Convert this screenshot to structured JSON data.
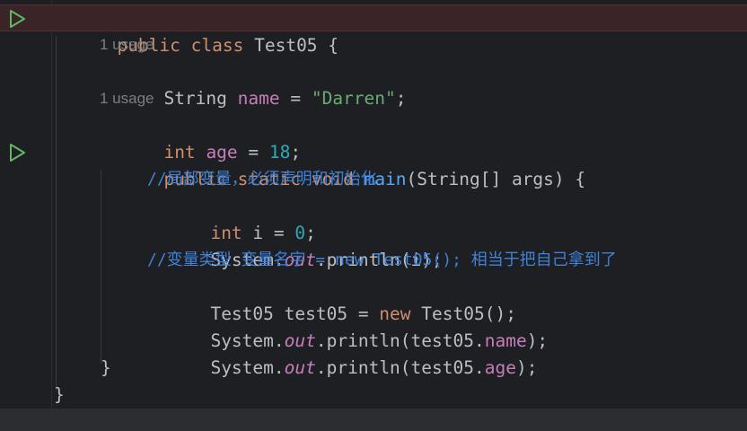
{
  "editor": {
    "lines": [
      {
        "id": "l1",
        "tokens": [
          "public",
          " ",
          "class",
          " ",
          "Test05",
          " {"
        ]
      },
      {
        "id": "h1",
        "hint": "1 usage"
      },
      {
        "id": "l2",
        "tokens": [
          "String",
          " ",
          "name",
          " = ",
          "\"Darren\"",
          ";"
        ]
      },
      {
        "id": "h2",
        "hint": "1 usage"
      },
      {
        "id": "l3",
        "tokens": [
          "int",
          " ",
          "age",
          " = ",
          "18",
          ";"
        ]
      },
      {
        "id": "l4",
        "tokens": [
          "public",
          " ",
          "static",
          " ",
          "void",
          " ",
          "main",
          "(String[] args) {"
        ]
      },
      {
        "id": "l5",
        "comment": "//局部变量，必须声明和初始化"
      },
      {
        "id": "l6",
        "tokens": [
          "int",
          " i = ",
          "0",
          ";"
        ]
      },
      {
        "id": "l7",
        "tokens": [
          "System.",
          "out",
          ".println(i);"
        ]
      },
      {
        "id": "l8",
        "comment": "//变量类型 变量名字 = new Test05(); 相当于把自己拿到了"
      },
      {
        "id": "l9",
        "tokens": [
          "Test05 test05 = ",
          "new",
          " Test05();"
        ]
      },
      {
        "id": "l10",
        "tokens": [
          "System.",
          "out",
          ".println(test05.",
          "name",
          ");"
        ]
      },
      {
        "id": "l11",
        "tokens": [
          "System.",
          "out",
          ".println(test05.",
          "age",
          ");"
        ]
      },
      {
        "id": "l12",
        "tokens": [
          "}"
        ]
      },
      {
        "id": "l13",
        "tokens": [
          "}"
        ]
      }
    ]
  },
  "gutter": {
    "run_icons": [
      "run-class-icon",
      "run-main-icon"
    ],
    "run_color": "#5fb865"
  },
  "colors": {
    "background": "#1e1f22",
    "keyword": "#cf8e6d",
    "field": "#c77dbb",
    "string": "#6aab73",
    "number": "#2aacb8",
    "method": "#56a8f5",
    "comment": "#3f82d9",
    "hint": "#7a7e85",
    "error_line": "#3a2427"
  }
}
